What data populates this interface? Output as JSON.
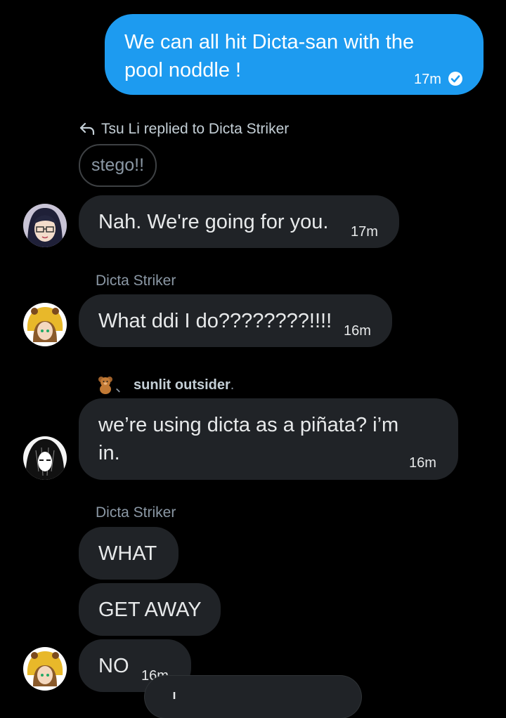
{
  "messages": {
    "m1": {
      "text": "We can all hit Dicta-san with the pool noddle !",
      "line1": "We can all hit Dicta-san with the",
      "line2": "pool noddle !",
      "time": "17m"
    },
    "reply": {
      "header": "Tsu Li replied to Dicta Striker",
      "quoted": "stego!!"
    },
    "m2": {
      "text": "Nah. We're going for you.",
      "time": "17m"
    },
    "dicta1": {
      "sender": "Dicta Striker",
      "text": "What ddi I do????????!!!!",
      "time": "16m"
    },
    "sunlit": {
      "sender": "sunlit outsider",
      "sender_suffix": ".",
      "separator": "、",
      "line1": "we’re using dicta as a piñata? i’m",
      "line2": "in.",
      "time": "16m"
    },
    "dicta2": {
      "sender": "Dicta Striker",
      "msg1": "WHAT",
      "msg2": "GET AWAY",
      "msg3": "NO",
      "time": "16m"
    }
  },
  "colors": {
    "accent": "#1d9bf0",
    "bubble": "#202327",
    "background": "#000000"
  }
}
